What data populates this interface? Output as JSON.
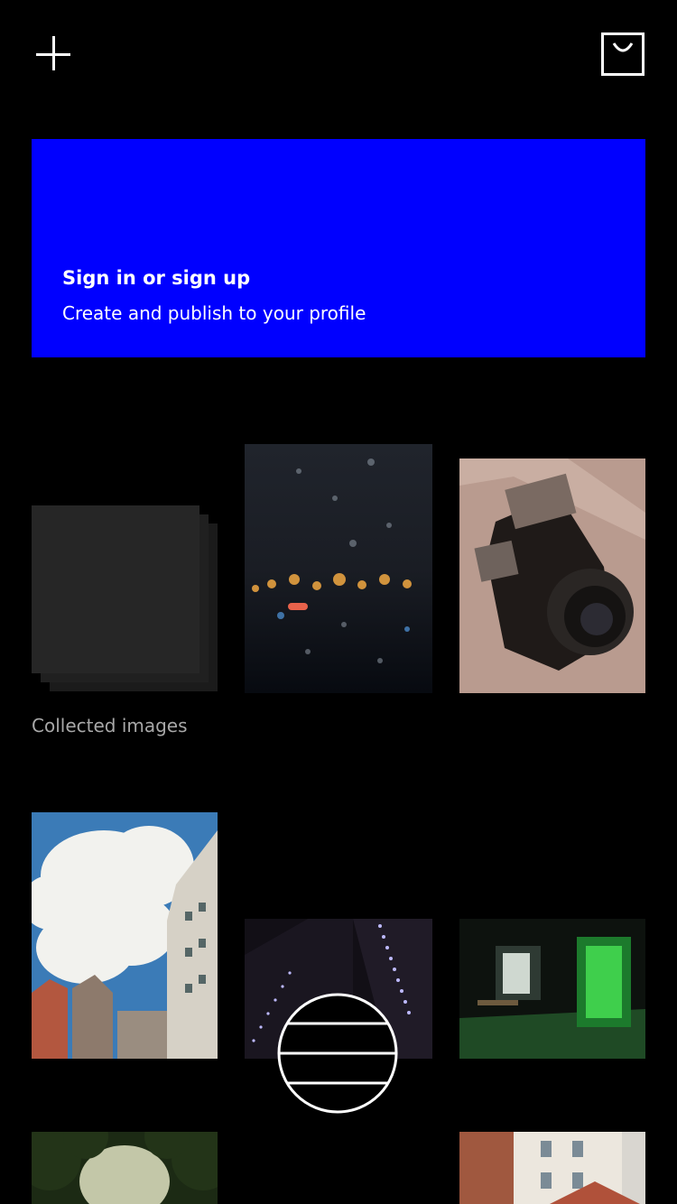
{
  "header": {
    "add_icon": "plus-icon",
    "bag_icon": "shopping-bag-icon"
  },
  "banner": {
    "title": "Sign in or sign up",
    "subtitle": "Create and publish to your profile",
    "color": "#0000ff"
  },
  "collection": {
    "label": "Collected images"
  },
  "fab": {
    "icon": "menu-lines-circle-icon"
  }
}
